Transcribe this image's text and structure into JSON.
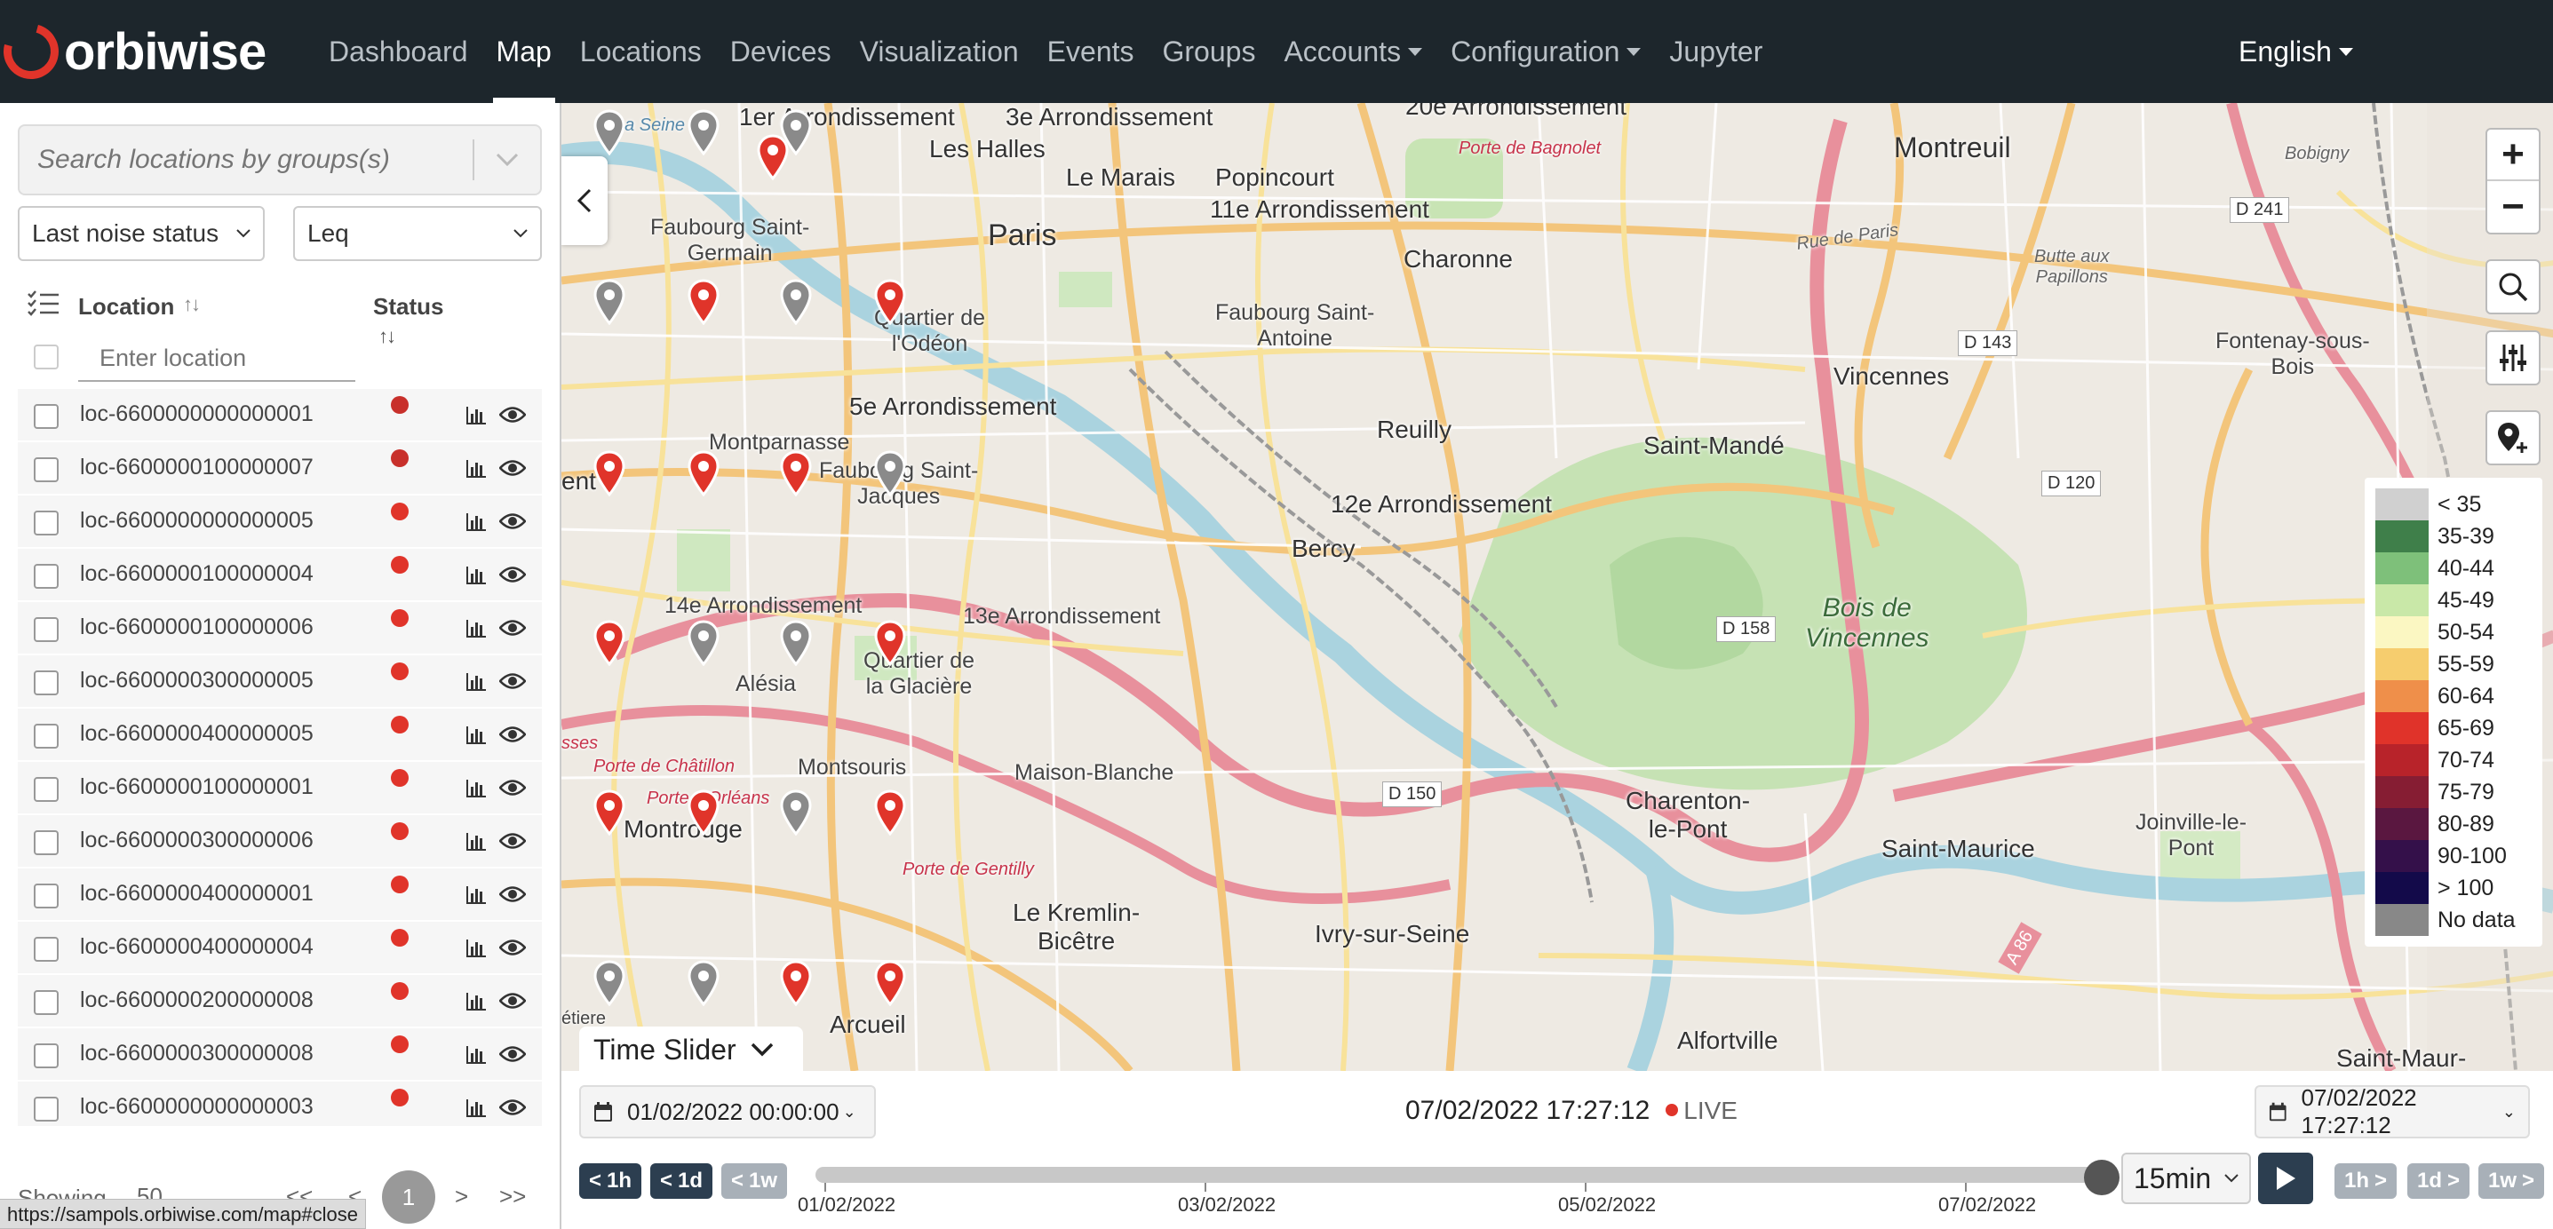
{
  "brand": {
    "name": "orbiwise"
  },
  "nav": {
    "items": [
      {
        "label": "Dashboard",
        "active": false,
        "dropdown": false
      },
      {
        "label": "Map",
        "active": true,
        "dropdown": false
      },
      {
        "label": "Locations",
        "active": false,
        "dropdown": false
      },
      {
        "label": "Devices",
        "active": false,
        "dropdown": false
      },
      {
        "label": "Visualization",
        "active": false,
        "dropdown": false
      },
      {
        "label": "Events",
        "active": false,
        "dropdown": false
      },
      {
        "label": "Groups",
        "active": false,
        "dropdown": false
      },
      {
        "label": "Accounts",
        "active": false,
        "dropdown": true
      },
      {
        "label": "Configuration",
        "active": false,
        "dropdown": true
      },
      {
        "label": "Jupyter",
        "active": false,
        "dropdown": false
      }
    ],
    "language": "English"
  },
  "sidebar": {
    "search_placeholder": "Search locations by groups(s)",
    "status_select": "Last noise status",
    "metric_select": "Leq",
    "col_location": "Location",
    "col_status": "Status",
    "location_filter_placeholder": "Enter location",
    "rows": [
      {
        "name": "loc-6600000000000001",
        "status_color": "#c8302b"
      },
      {
        "name": "loc-6600000100000007",
        "status_color": "#c8302b"
      },
      {
        "name": "loc-6600000000000005",
        "status_color": "#e0342a"
      },
      {
        "name": "loc-6600000100000004",
        "status_color": "#e0342a"
      },
      {
        "name": "loc-6600000100000006",
        "status_color": "#e0342a"
      },
      {
        "name": "loc-6600000300000005",
        "status_color": "#e0342a"
      },
      {
        "name": "loc-6600000400000005",
        "status_color": "#e0342a"
      },
      {
        "name": "loc-6600000100000001",
        "status_color": "#e0342a"
      },
      {
        "name": "loc-6600000300000006",
        "status_color": "#e0342a"
      },
      {
        "name": "loc-6600000400000001",
        "status_color": "#e0342a"
      },
      {
        "name": "loc-6600000400000004",
        "status_color": "#e0342a"
      },
      {
        "name": "loc-6600000200000008",
        "status_color": "#e0342a"
      },
      {
        "name": "loc-6600000300000008",
        "status_color": "#e0342a"
      },
      {
        "name": "loc-6600000000000003",
        "status_color": "#e0342a"
      }
    ],
    "pager": {
      "showing_label": "Showing",
      "page_size": "50",
      "first": "<<",
      "prev": "<",
      "current": "1",
      "next": ">",
      "last": ">>"
    }
  },
  "status_url": "https://sampols.orbiwise.com/map#close",
  "map": {
    "labels": {
      "arr1": "1er Arrondissement",
      "arr3": "3e Arrondissement",
      "arr20": "20e Arrondissement",
      "montreuil": "Montreuil",
      "porte_bagnolet": "Porte de Bagnolet",
      "bobigny": "Bobigny",
      "les_halles": "Les Halles",
      "le_marais": "Le Marais",
      "popincourt": "Popincourt",
      "arr11": "11e Arrondissement",
      "paris": "Paris",
      "faubourg_st_germain": "Faubourg Saint-\nGermain",
      "charonne": "Charonne",
      "rue_de_paris": "Rue de Paris",
      "butte": "Butte aux\nPapillons",
      "quartier_odeon": "Quartier de\nl'Odéon",
      "faubourg_st_antoine": "Faubourg Saint-\nAntoine",
      "vincennes": "Vincennes",
      "fontenay": "Fontenay-sous-\nBois",
      "arr5": "5e Arrondissement",
      "reuilly": "Reuilly",
      "saint_mande": "Saint-Mandé",
      "montparnasse": "Montparnasse",
      "faubourg_st_jacques": "Faubourg Saint-\nJacques",
      "arr12": "12e Arrondissement",
      "bercy": "Bercy",
      "arr14": "14e Arrondissement",
      "arr13": "13e Arrondissement",
      "bois_vincennes": "Bois de\nVincennes",
      "quartier_glaciere": "Quartier de\nla Glacière",
      "alesia": "Alésia",
      "montsouris": "Montsouris",
      "maison_blanche": "Maison-Blanche",
      "charenton": "Charenton-\nle-Pont",
      "porte_chatillon": "Porte de Châtillon",
      "porte_orleans": "Porte d'Orléans",
      "montrouge": "Montrouge",
      "saint_maurice": "Saint-Maurice",
      "joinville": "Joinville-le-\nPont",
      "porte_gentilly": "Porte de Gentilly",
      "kremlin": "Le Kremlin-\nBicêtre",
      "ivry": "Ivry-sur-Seine",
      "arcueil": "Arcueil",
      "alfortville": "Alfortville",
      "saint_maur": "Saint-Maur-",
      "seine": "La Seine",
      "ent": "ent",
      "etiere": "étiere",
      "sses": "sses"
    },
    "road_tags": [
      "D 241",
      "D 143",
      "D 120",
      "D 158",
      "D 150",
      "A 86"
    ],
    "markers": [
      {
        "x": 0.128,
        "y": 0.108,
        "color": "red"
      },
      {
        "x": 0.165,
        "y": 0.108,
        "color": "red"
      },
      {
        "x": 0.201,
        "y": 0.108,
        "color": "red"
      },
      {
        "x": 0.238,
        "y": 0.108,
        "color": "gray"
      },
      {
        "x": 0.275,
        "y": 0.108,
        "color": "gray"
      },
      {
        "x": 0.311,
        "y": 0.108,
        "color": "gray"
      },
      {
        "x": 0.302,
        "y": 0.128,
        "color": "red"
      },
      {
        "x": 0.128,
        "y": 0.246,
        "color": "red"
      },
      {
        "x": 0.165,
        "y": 0.246,
        "color": "red"
      },
      {
        "x": 0.201,
        "y": 0.246,
        "color": "red"
      },
      {
        "x": 0.238,
        "y": 0.246,
        "color": "gray"
      },
      {
        "x": 0.275,
        "y": 0.246,
        "color": "red"
      },
      {
        "x": 0.311,
        "y": 0.246,
        "color": "gray"
      },
      {
        "x": 0.348,
        "y": 0.246,
        "color": "red"
      },
      {
        "x": 0.128,
        "y": 0.385,
        "color": "gray"
      },
      {
        "x": 0.165,
        "y": 0.385,
        "color": "gray"
      },
      {
        "x": 0.201,
        "y": 0.385,
        "color": "gray"
      },
      {
        "x": 0.238,
        "y": 0.385,
        "color": "red"
      },
      {
        "x": 0.275,
        "y": 0.385,
        "color": "red"
      },
      {
        "x": 0.311,
        "y": 0.385,
        "color": "red"
      },
      {
        "x": 0.348,
        "y": 0.385,
        "color": "gray"
      },
      {
        "x": 0.128,
        "y": 0.523,
        "color": "gray"
      },
      {
        "x": 0.165,
        "y": 0.523,
        "color": "gray"
      },
      {
        "x": 0.201,
        "y": 0.523,
        "color": "gray"
      },
      {
        "x": 0.238,
        "y": 0.523,
        "color": "red"
      },
      {
        "x": 0.275,
        "y": 0.523,
        "color": "gray"
      },
      {
        "x": 0.311,
        "y": 0.523,
        "color": "gray"
      },
      {
        "x": 0.348,
        "y": 0.523,
        "color": "red"
      },
      {
        "x": 0.128,
        "y": 0.661,
        "color": "gray"
      },
      {
        "x": 0.165,
        "y": 0.661,
        "color": "gray"
      },
      {
        "x": 0.201,
        "y": 0.661,
        "color": "gray"
      },
      {
        "x": 0.238,
        "y": 0.661,
        "color": "red"
      },
      {
        "x": 0.275,
        "y": 0.661,
        "color": "red"
      },
      {
        "x": 0.311,
        "y": 0.661,
        "color": "gray"
      },
      {
        "x": 0.348,
        "y": 0.661,
        "color": "red"
      },
      {
        "x": 0.128,
        "y": 0.8,
        "color": "red"
      },
      {
        "x": 0.165,
        "y": 0.8,
        "color": "red"
      },
      {
        "x": 0.201,
        "y": 0.8,
        "color": "gray"
      },
      {
        "x": 0.238,
        "y": 0.8,
        "color": "gray"
      },
      {
        "x": 0.275,
        "y": 0.8,
        "color": "gray"
      },
      {
        "x": 0.311,
        "y": 0.8,
        "color": "red"
      },
      {
        "x": 0.348,
        "y": 0.8,
        "color": "red"
      },
      {
        "x": 0.128,
        "y": 0.939,
        "color": "gray"
      },
      {
        "x": 0.165,
        "y": 0.939,
        "color": "gray"
      },
      {
        "x": 0.201,
        "y": 0.939,
        "color": "gray"
      },
      {
        "x": 0.238,
        "y": 0.939,
        "color": "gray"
      },
      {
        "x": 0.275,
        "y": 0.939,
        "color": "gray"
      },
      {
        "x": 0.311,
        "y": 0.939,
        "color": "red"
      },
      {
        "x": 0.348,
        "y": 0.939,
        "color": "gray"
      }
    ],
    "legend": [
      {
        "label": "< 35",
        "color": "#d0d0d0"
      },
      {
        "label": "35-39",
        "color": "#3f7f4a"
      },
      {
        "label": "40-44",
        "color": "#7ec07a"
      },
      {
        "label": "45-49",
        "color": "#c9e8a8"
      },
      {
        "label": "50-54",
        "color": "#fbf7c2"
      },
      {
        "label": "55-59",
        "color": "#f6cd6e"
      },
      {
        "label": "60-64",
        "color": "#ef8f4a"
      },
      {
        "label": "65-69",
        "color": "#e0332a"
      },
      {
        "label": "70-74",
        "color": "#b8232a"
      },
      {
        "label": "75-79",
        "color": "#861d33"
      },
      {
        "label": "80-89",
        "color": "#5a1740"
      },
      {
        "label": "90-100",
        "color": "#34104a"
      },
      {
        "label": "> 100",
        "color": "#130a4a"
      },
      {
        "label": "No data",
        "color": "#888888"
      }
    ],
    "time_slider_label": "Time Slider"
  },
  "timebar": {
    "start": "01/02/2022 00:00:00",
    "now": "07/02/2022 17:27:12",
    "live": "LIVE",
    "end": "07/02/2022 17:27:12",
    "back_1h": "1h",
    "back_1d": "1d",
    "back_1w": "1w",
    "fwd_1h": "1h",
    "fwd_1d": "1d",
    "fwd_1w": "1w",
    "interval": "15min",
    "ticks": [
      "01/02/2022",
      "03/02/2022",
      "05/02/2022",
      "07/02/2022"
    ]
  }
}
